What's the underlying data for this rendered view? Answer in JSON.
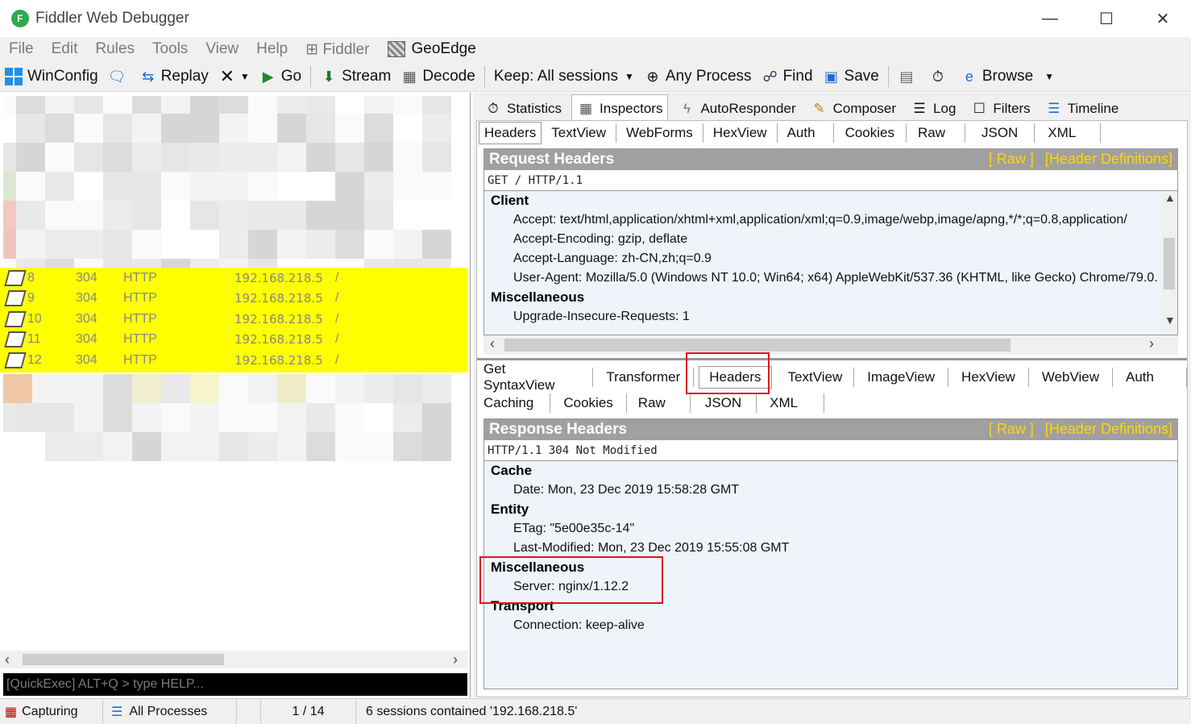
{
  "window": {
    "title": "Fiddler Web Debugger",
    "logo_letter": "F",
    "controls": [
      "—",
      "☐",
      "✕"
    ]
  },
  "menu": [
    "File",
    "Edit",
    "Rules",
    "Tools",
    "View",
    "Help",
    "Fiddler",
    "GeoEdge"
  ],
  "toolbar": {
    "winconfig": "WinConfig",
    "replay": "Replay",
    "go": "Go",
    "stream": "Stream",
    "decode": "Decode",
    "keep": "Keep: All sessions",
    "any_process": "Any Process",
    "find": "Find",
    "save": "Save",
    "browse": "Browse"
  },
  "sessions": [
    {
      "num": "8",
      "result": "304",
      "protocol": "HTTP",
      "host": "192.168.218.5",
      "url": "/"
    },
    {
      "num": "9",
      "result": "304",
      "protocol": "HTTP",
      "host": "192.168.218.5",
      "url": "/"
    },
    {
      "num": "10",
      "result": "304",
      "protocol": "HTTP",
      "host": "192.168.218.5",
      "url": "/"
    },
    {
      "num": "11",
      "result": "304",
      "protocol": "HTTP",
      "host": "192.168.218.5",
      "url": "/"
    },
    {
      "num": "12",
      "result": "304",
      "protocol": "HTTP",
      "host": "192.168.218.5",
      "url": "/"
    }
  ],
  "quickexec": "[QuickExec] ALT+Q > type HELP...",
  "main_tabs": [
    "Statistics",
    "Inspectors",
    "AutoResponder",
    "Composer",
    "Log",
    "Filters",
    "Timeline"
  ],
  "request_tabs": [
    "Headers",
    "TextView",
    "WebForms",
    "HexView",
    "Auth",
    "Cookies",
    "Raw",
    "JSON",
    "XML"
  ],
  "request": {
    "title": "Request Headers",
    "raw_link": "[ Raw ]",
    "defs_link": "[Header Definitions]",
    "first_line": "GET / HTTP/1.1",
    "groups": [
      {
        "name": "Client",
        "items": [
          "Accept: text/html,application/xhtml+xml,application/xml;q=0.9,image/webp,image/apng,*/*;q=0.8,application/",
          "Accept-Encoding: gzip, deflate",
          "Accept-Language: zh-CN,zh;q=0.9",
          "User-Agent: Mozilla/5.0 (Windows NT 10.0; Win64; x64) AppleWebKit/537.36 (KHTML, like Gecko) Chrome/79.0."
        ]
      },
      {
        "name": "Miscellaneous",
        "items": [
          "Upgrade-Insecure-Requests: 1"
        ]
      }
    ]
  },
  "response_tabs_row1": [
    "Get SyntaxView",
    "Transformer",
    "Headers",
    "TextView",
    "ImageView",
    "HexView",
    "WebView",
    "Auth"
  ],
  "response_tabs_row2": [
    "Caching",
    "Cookies",
    "Raw",
    "JSON",
    "XML"
  ],
  "response": {
    "title": "Response Headers",
    "raw_link": "[ Raw ]",
    "defs_link": "[Header Definitions]",
    "first_line": "HTTP/1.1 304 Not Modified",
    "groups": [
      {
        "name": "Cache",
        "items": [
          "Date: Mon, 23 Dec 2019 15:58:28 GMT"
        ]
      },
      {
        "name": "Entity",
        "items": [
          "ETag: \"5e00e35c-14\"",
          "Last-Modified: Mon, 23 Dec 2019 15:55:08 GMT"
        ]
      },
      {
        "name": "Miscellaneous",
        "items": [
          "Server: nginx/1.12.2"
        ]
      },
      {
        "name": "Transport",
        "items": [
          "Connection: keep-alive"
        ]
      }
    ]
  },
  "status": {
    "capturing": "Capturing",
    "processes": "All Processes",
    "count": "1 / 14",
    "message": "6 sessions contained '192.168.218.5'"
  },
  "colors": {
    "highlight": "#ffff00",
    "annotation": "#e0141e",
    "header_link": "#ffd700"
  }
}
